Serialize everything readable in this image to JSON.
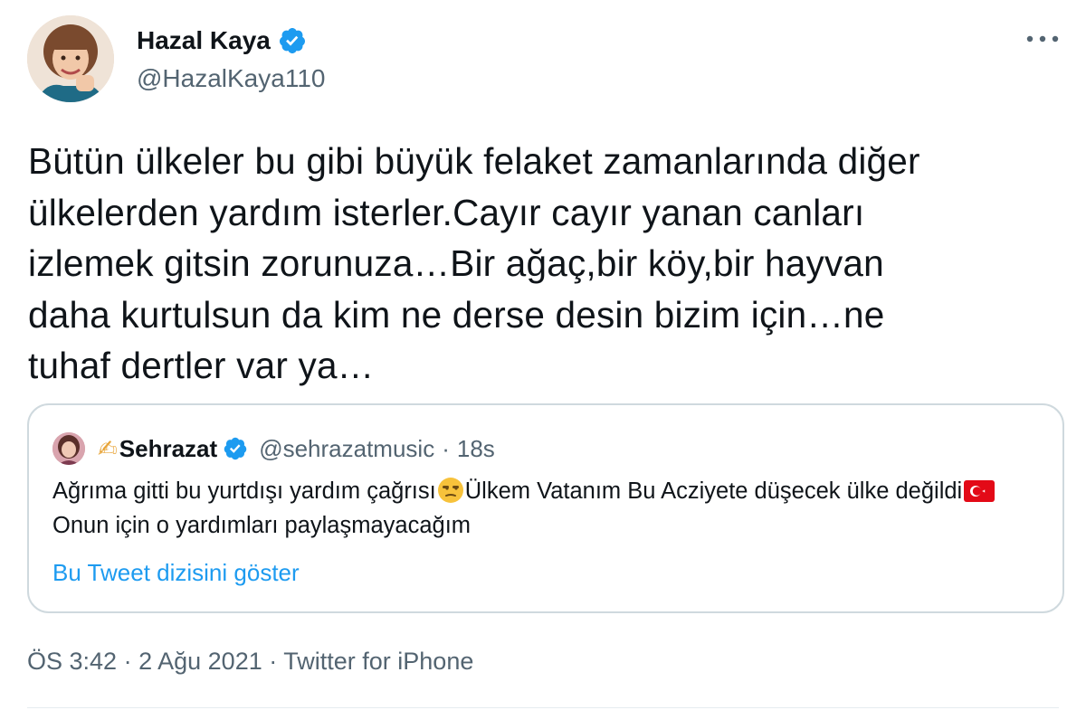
{
  "author": {
    "name": "Hazal Kaya",
    "handle": "@HazalKaya110",
    "verified": true
  },
  "tweet": {
    "text": "Bütün ülkeler bu gibi büyük felaket zamanlarında diğer\nülkelerden yardım isterler.Cayır cayır yanan canları\nizlemek gitsin zorunuza…Bir ağaç,bir köy,bir hayvan\ndaha kurtulsun da kim ne derse desin bizim için…ne\ntuhaf dertler var ya…"
  },
  "quoted": {
    "prefix_emoji": "✍",
    "name": "Sehrazat",
    "handle": "@sehrazatmusic",
    "separator": "·",
    "time": "18s",
    "text_part1": "Ağrıma gitti bu yurtdışı yardım çağrısı",
    "text_part2": "Ülkem Vatanım Bu Acziyete düşecek ülke değildi",
    "text_part3": "Onun için o yardımları paylaşmayacağım",
    "emoji_face": "unamused-face",
    "emoji_flag": "turkey-flag",
    "thread_link": "Bu Tweet dizisini göster"
  },
  "meta": {
    "time": "ÖS 3:42",
    "separator": "·",
    "date": "2 Ağu 2021",
    "source": "Twitter for iPhone"
  },
  "colors": {
    "verified": "#1d9bf0",
    "link": "#1d9bf0",
    "secondary_text": "#536471",
    "border": "#cfd9de"
  }
}
